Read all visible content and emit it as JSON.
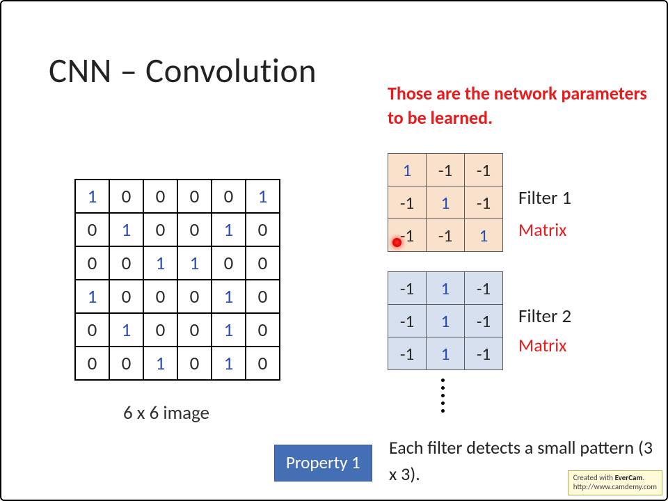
{
  "title": "CNN – Convolution",
  "red_note": "Those are the network parameters to be learned.",
  "image": {
    "caption": "6 x 6 image",
    "rows": [
      [
        1,
        0,
        0,
        0,
        0,
        1
      ],
      [
        0,
        1,
        0,
        0,
        1,
        0
      ],
      [
        0,
        0,
        1,
        1,
        0,
        0
      ],
      [
        1,
        0,
        0,
        0,
        1,
        0
      ],
      [
        0,
        1,
        0,
        0,
        1,
        0
      ],
      [
        0,
        0,
        1,
        0,
        1,
        0
      ]
    ]
  },
  "filters": {
    "f1": {
      "label": "Filter 1",
      "sublabel": "Matrix",
      "rows": [
        [
          1,
          -1,
          -1
        ],
        [
          -1,
          1,
          -1
        ],
        [
          -1,
          -1,
          1
        ]
      ]
    },
    "f2": {
      "label": "Filter 2",
      "sublabel": "Matrix",
      "rows": [
        [
          -1,
          1,
          -1
        ],
        [
          -1,
          1,
          -1
        ],
        [
          -1,
          1,
          -1
        ]
      ]
    }
  },
  "property": {
    "label": "Property 1",
    "text": "Each filter detects a small pattern (3 x 3)."
  },
  "watermark": {
    "line1_pre": "Created with ",
    "line1_bold": "EverCam",
    "line1_post": ".",
    "line2": "http://www.camdemy.com"
  }
}
